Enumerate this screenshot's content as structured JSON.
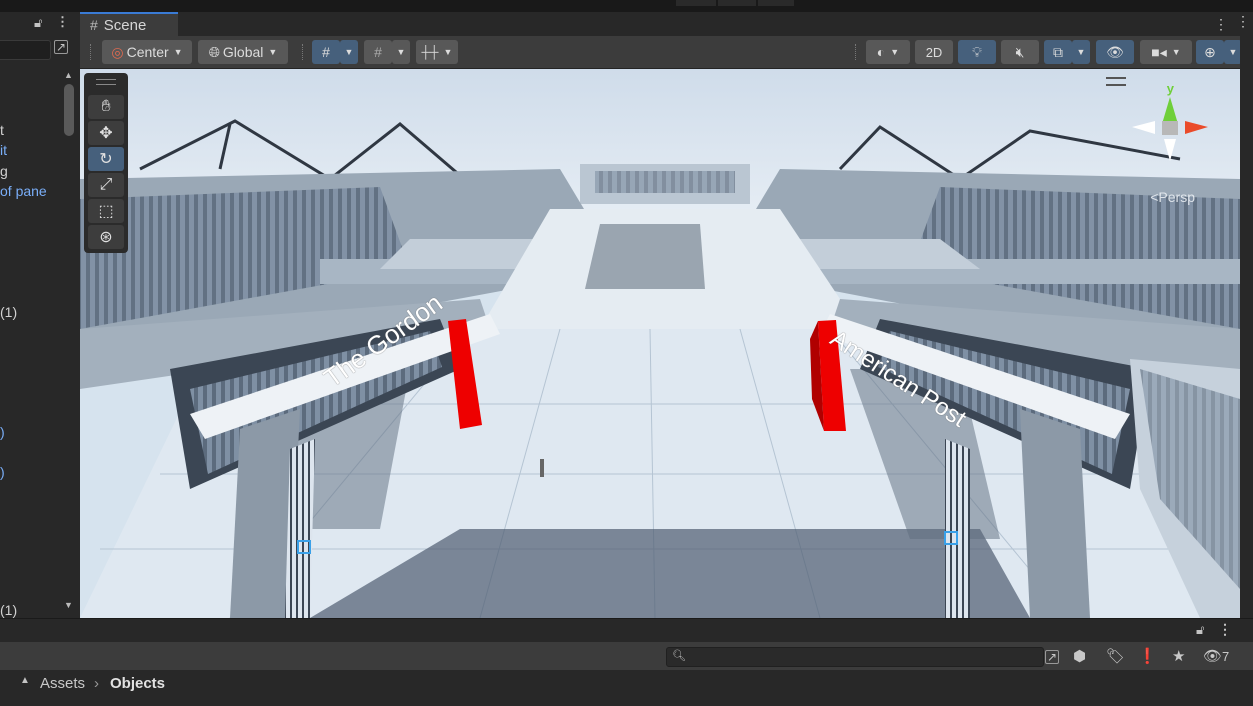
{
  "hierarchy": {
    "rows": [
      {
        "text": "t",
        "style": "white"
      },
      {
        "text": "it",
        "style": "blue"
      },
      {
        "text": "g",
        "style": "white"
      },
      {
        "text": "of pane",
        "style": "blue"
      },
      {
        "text": " (1)",
        "style": "white"
      },
      {
        "text": ")",
        "style": "blue"
      },
      {
        "text": ")",
        "style": "blue"
      },
      {
        "text": "(1)",
        "style": "white"
      }
    ]
  },
  "scene": {
    "tab_label": "Scene",
    "toolbar": {
      "pivot_label": "Center",
      "space_label": "Global",
      "mode_2d_label": "2D"
    },
    "view": {
      "projection_label": "Persp",
      "gizmo_axis_label": "y",
      "sign_left": "The Gordon",
      "sign_right": "American Post"
    }
  },
  "project": {
    "search_placeholder": "",
    "hidden_count": "7",
    "breadcrumb": [
      "Assets",
      "Objects"
    ]
  },
  "colors": {
    "accent": "#3a7bd5",
    "active_button": "#46607c",
    "red_pillar": "#ee0000",
    "sky": "#d6e3ee"
  }
}
